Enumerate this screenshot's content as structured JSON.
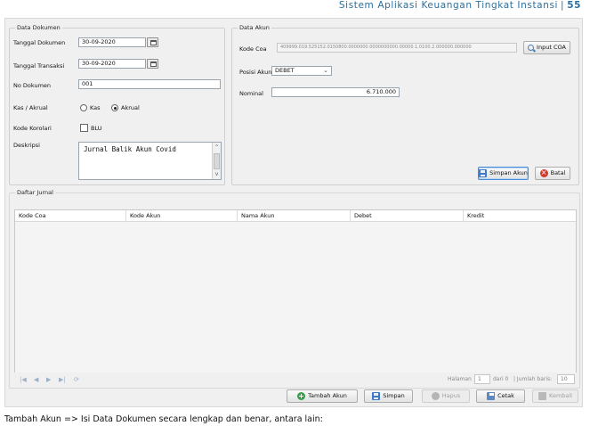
{
  "doc_header": {
    "title": "Sistem Aplikasi Keuangan Tingkat Instansi",
    "separator": "|",
    "page": "55"
  },
  "data_dokumen": {
    "group_title": "Data Dokumen",
    "tanggal_dokumen": {
      "label": "Tanggal Dokumen",
      "value": "30-09-2020"
    },
    "tanggal_transaksi": {
      "label": "Tanggal Transaksi",
      "value": "30-09-2020"
    },
    "no_dokumen": {
      "label": "No Dokumen",
      "value": "001"
    },
    "kas_akrual": {
      "label": "Kas / Akrual",
      "options": [
        "Kas",
        "Akrual"
      ],
      "selected": "Akrual"
    },
    "kode_korolari": {
      "label": "Kode Korolari",
      "checkbox_label": "BLU",
      "checked": false
    },
    "deskripsi": {
      "label": "Deskripsi",
      "value": "Jurnal Balik Akun Covid"
    }
  },
  "data_akun": {
    "group_title": "Data Akun",
    "kode_coa": {
      "label": "Kode Coa",
      "value": "409999.019.525152.0150800.0000000.0000000000.00000.1.0100.2.000000.000000"
    },
    "input_coa_button": "Input COA",
    "posisi_akun": {
      "label": "Posisi Akun",
      "value": "DEBET"
    },
    "nominal": {
      "label": "Nominal",
      "value": "6.710.000"
    },
    "simpan_akun_button": "Simpan Akun",
    "batal_button": "Batal"
  },
  "daftar_jurnal": {
    "group_title": "Daftar Jurnal",
    "columns": [
      "Kode Coa",
      "Kode Akun",
      "Nama Akun",
      "Debet",
      "Kredit"
    ],
    "rows": []
  },
  "pager": {
    "halaman_label": "Halaman",
    "page_value": "1",
    "dari_text": "dari 0",
    "jumlah_text": "| Jumlah baris:",
    "rows_per_page": "10"
  },
  "footer_buttons": {
    "tambah_akun": "Tambah Akun",
    "simpan": "Simpan",
    "hapus": "Hapus",
    "cetak": "Cetak",
    "kembali": "Kembali"
  },
  "caption": "Tambah Akun => Isi Data Dokumen secara lengkap dan benar, antara lain:",
  "colors": {
    "accent_header": "#2a6f9e",
    "add_green": "#37a04a",
    "cancel_red": "#d23a2c",
    "save_blue": "#3d7ac7"
  }
}
